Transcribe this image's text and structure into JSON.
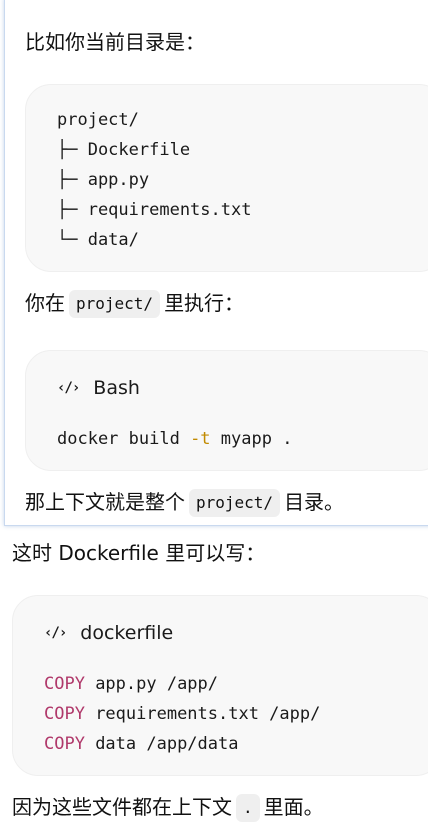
{
  "colors": {
    "keyword": "#b0396b",
    "flag": "#c18a00",
    "code_bg": "#f8f8f8"
  },
  "para1": "比如你当前目录是：",
  "tree": [
    "project/",
    "├─ Dockerfile",
    "├─ app.py",
    "├─ requirements.txt",
    "└─ data/"
  ],
  "para2": {
    "before": "你在",
    "code": "project/",
    "after": "里执行："
  },
  "bash": {
    "lang": "Bash",
    "icon": "code-icon",
    "cmd": "docker build ",
    "flag": "-t",
    "rest": " myapp ."
  },
  "para3": {
    "before": "那上下文就是整个",
    "code": "project/",
    "after": "目录。"
  },
  "para4": "这时 Dockerfile 里可以写：",
  "dockerfile": {
    "lang": "dockerfile",
    "icon": "code-icon",
    "lines": [
      {
        "kw": "COPY",
        "rest": " app.py /app/"
      },
      {
        "kw": "COPY",
        "rest": " requirements.txt /app/"
      },
      {
        "kw": "COPY",
        "rest": " data /app/data"
      }
    ]
  },
  "para5": {
    "before": "因为这些文件都在上下文",
    "code": ".",
    "after": "里面。"
  }
}
